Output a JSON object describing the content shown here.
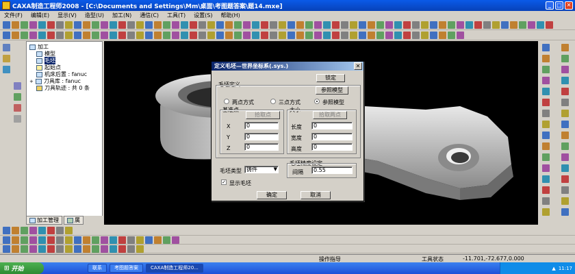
{
  "window": {
    "title": "CAXA制造工程师2008 - [C:\\Documents and Settings\\Mm\\桌面\\考图题答案\\题14.mxe]"
  },
  "menu": [
    "文件(F)",
    "编辑(E)",
    "显示(V)",
    "造型(U)",
    "加工(N)",
    "通信(C)",
    "工具(T)",
    "设置(S)",
    "帮助(H)"
  ],
  "tree": {
    "root": "加工",
    "items": [
      "模型",
      "毛坯",
      "起始点",
      "机床后置 : fanuc",
      "刀具库 : fanuc",
      "刀具轨迹 : 共 0 条"
    ],
    "selected_index": 1
  },
  "panel_tabs": [
    "加工管理",
    "属"
  ],
  "dialog": {
    "title": "定义毛坯—世界坐标系(.sys.)",
    "close": "✕",
    "ok_top": "锁定",
    "group_def": "毛坯定义",
    "ref_model_btn": "参照模型",
    "radio_two": "两点方式",
    "radio_three": "三点方式",
    "radio_ref": "参照模型",
    "group_base": "基准点",
    "pick_point": "拾取点",
    "x_label": "X",
    "x_value": "0",
    "y_label": "Y",
    "y_value": "0",
    "z_label": "Z",
    "z_value": "0",
    "group_size": "大小",
    "pick_two": "拾取两点",
    "len_label": "长度",
    "len_value": "0",
    "wid_label": "宽度",
    "wid_value": "0",
    "hei_label": "高度",
    "hei_value": "0",
    "type_label": "毛坯类型",
    "type_value": "铸件",
    "precision_group": "毛坯精度设定",
    "gap_label": "间隔",
    "gap_value": "0.55",
    "show_label": "显示毛坯",
    "ok": "确定",
    "cancel": "取消"
  },
  "status": {
    "prompt": "操作指导",
    "tool_state": "工具状态",
    "coords": "-11.701,-72.677,0.000"
  },
  "taskbar": {
    "start": "开始",
    "tasks": [
      "联系",
      "考图题答案",
      "CAXA制造工程师20..."
    ],
    "clock": "11:17"
  },
  "colors": {
    "titlebar": "#0a5ae8",
    "viewport_bg": "#000000",
    "selection": "#0a246a",
    "taskbar": "#245edb",
    "start": "#3c9a3c"
  }
}
